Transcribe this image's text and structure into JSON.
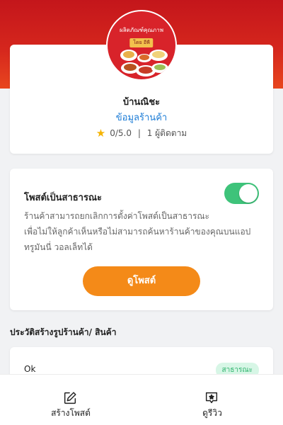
{
  "shop": {
    "logo_text": "ผลิตภัณฑ์คุณภาพ",
    "logo_sub": "โดย อีพี",
    "name": "บ้านณิชะ",
    "info_link": "ข้อมูลร้านค้า",
    "rating": "0/5.0",
    "separator": "|",
    "followers": "1 ผู้ติดตาม"
  },
  "public_setting": {
    "title": "โพสต์เป็นสาธารณะ",
    "toggle_on": true,
    "description_line1": "ร้านค้าสามารถยกเลิกการตั้งค่าโพสต์เป็นสาธารณะ",
    "description_line2": "เพื่อไม่ให้ลูกค้าเห็นหรือไม่สามารถค้นหาร้านค้าของคุณบนแอป",
    "description_line3": "ทรูมันนี่ วอลเล็ทได้",
    "button_label": "ดูโพสต์"
  },
  "history": {
    "heading": "ประวัติสร้างรูปร้านค้า/ สินค้า",
    "items": [
      {
        "name": "Ok",
        "status": "สาธารณะ"
      }
    ]
  },
  "bottom_bar": {
    "create_post_label": "สร้างโพสต์",
    "create_post_icon": "edit-icon",
    "review_label": "ดูรีวิว",
    "review_icon": "star-message-icon"
  },
  "colors": {
    "header": "#d5261d",
    "toggle_on": "#3ec37a",
    "button": "#f48a18",
    "link": "#1a7bd6",
    "badge_bg": "#d7f6e6",
    "badge_text": "#2fb36d"
  }
}
